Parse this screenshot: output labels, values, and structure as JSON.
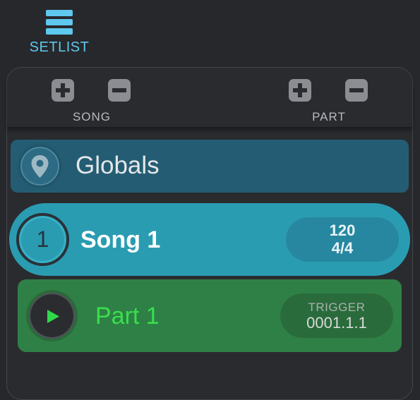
{
  "header": {
    "setlist_label": "SETLIST",
    "icon": "hamburger-menu-icon"
  },
  "toolbar": {
    "song_label": "SONG",
    "part_label": "PART",
    "icons": [
      "plus-square-icon",
      "minus-square-icon"
    ]
  },
  "globals": {
    "label": "Globals",
    "icon": "location-pin-icon"
  },
  "song": {
    "number": "1",
    "name": "Song 1",
    "tempo": "120",
    "time_signature": "4/4"
  },
  "part": {
    "name": "Part 1",
    "trigger_label": "TRIGGER",
    "trigger_value": "0001.1.1",
    "icon": "play-icon"
  },
  "colors": {
    "background": "#27282c",
    "accent_blue": "#5ec8ee",
    "globals_row": "#245d73",
    "song_row": "#2a9cb2",
    "part_row": "#2f8047",
    "part_text": "#37e04a"
  }
}
